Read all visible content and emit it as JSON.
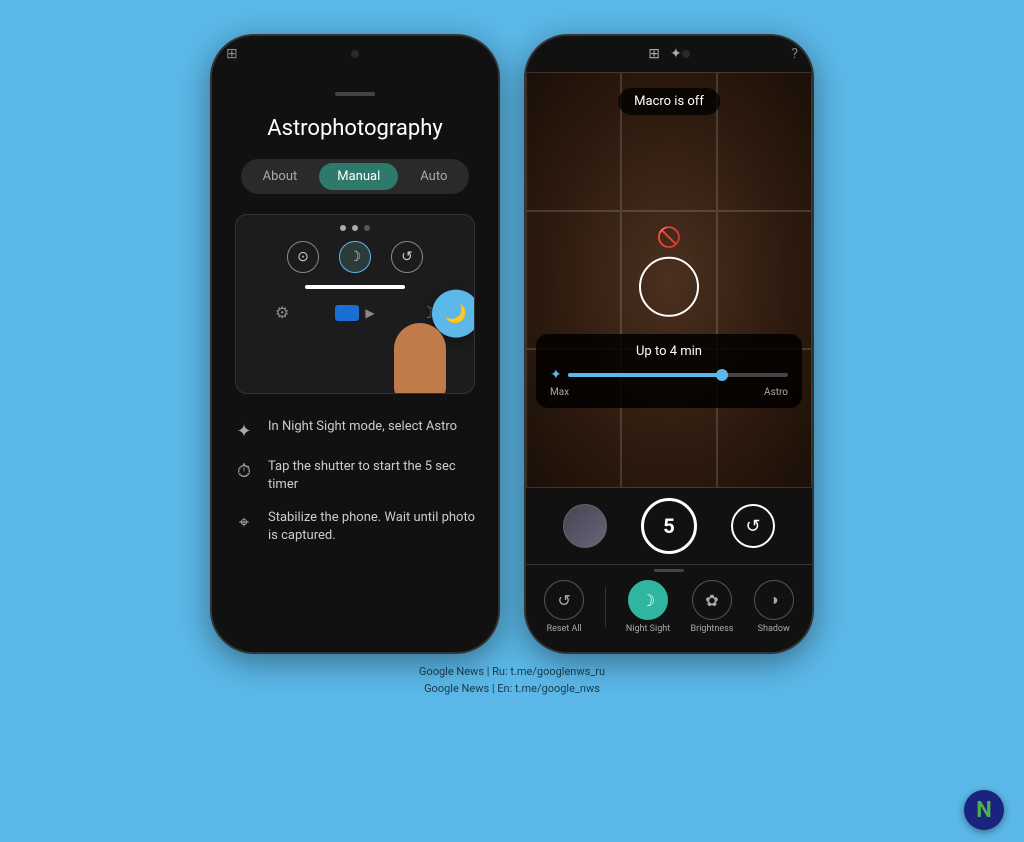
{
  "page": {
    "background_color": "#5bb8e8"
  },
  "left_phone": {
    "top_icon": "⊞",
    "sheet_handle": true,
    "title": "Astrophotography",
    "tabs": [
      {
        "label": "About",
        "active": false
      },
      {
        "label": "Manual",
        "active": true
      },
      {
        "label": "Auto",
        "active": false
      }
    ],
    "steps": [
      {
        "icon": "✦",
        "text": "In Night Sight mode, select Astro"
      },
      {
        "icon": "⏱",
        "text": "Tap the shutter to start the 5 sec timer"
      },
      {
        "icon": "⌖",
        "text": "Stabilize the phone. Wait until photo is captured."
      }
    ]
  },
  "right_phone": {
    "top_left_icons": [
      "⊞",
      "✦"
    ],
    "top_right_icon": "?",
    "macro_badge": "Macro is off",
    "focus_label": "",
    "astro_duration": "Up to 4 min",
    "slider_labels": [
      "Max",
      "Astro"
    ],
    "shutter_number": "5",
    "modes": [
      {
        "icon": "↺",
        "label": "Reset All",
        "active": false
      },
      {
        "icon": "☽",
        "label": "Night Sight",
        "active": true
      },
      {
        "icon": "✿",
        "label": "Brightness",
        "active": false
      },
      {
        "icon": "◑",
        "label": "Shadow",
        "active": false
      }
    ]
  },
  "footer": {
    "line1": "Google News | Ru: t.me/googlenws_ru",
    "line2": "Google News | En: t.me/google_nws"
  },
  "n_logo": "N"
}
